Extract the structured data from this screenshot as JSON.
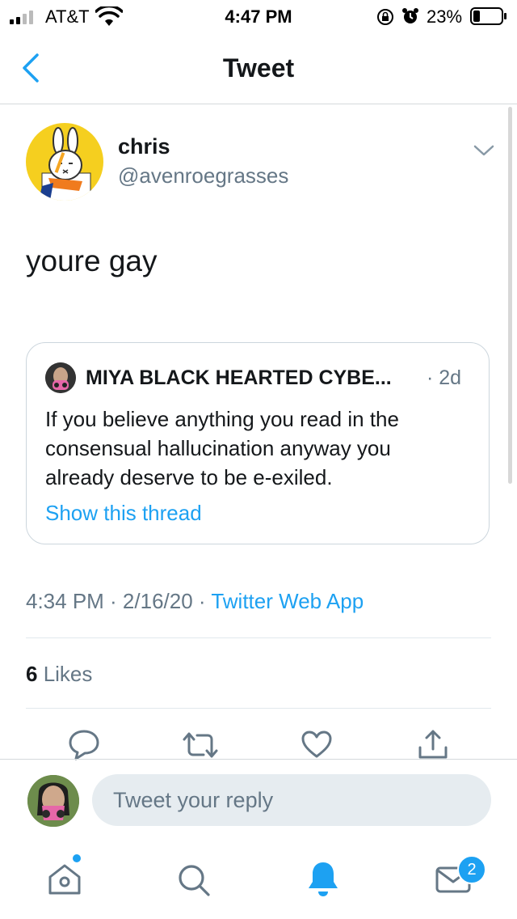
{
  "status_bar": {
    "carrier": "AT&T",
    "time": "4:47 PM",
    "battery": "23%"
  },
  "header": {
    "title": "Tweet"
  },
  "tweet": {
    "name": "chris",
    "handle": "@avenroegrasses",
    "text": "youre gay",
    "timestamp": "4:34 PM · 2/16/20 · ",
    "source": "Twitter Web App",
    "likes_count": "6",
    "likes_label": " Likes"
  },
  "quoted_tweet": {
    "name": "MIYA BLACK HEARTED CYBE...",
    "time": "· 2d",
    "text": "If you believe anything you read in the consensual hallucination anyway you already deserve to be e-exiled.",
    "link": "Show this thread"
  },
  "reply": {
    "placeholder": "Tweet your reply"
  },
  "tabbar": {
    "messages_badge": "2"
  },
  "colors": {
    "accent": "#1da1f2",
    "secondary_text": "#657786",
    "border": "#ccd6dd"
  },
  "icons": [
    "back-chevron-icon",
    "caret-down-icon",
    "reply-icon",
    "retweet-icon",
    "like-icon",
    "share-icon",
    "home-icon",
    "search-icon",
    "notifications-bell-icon",
    "messages-envelope-icon",
    "wifi-icon",
    "battery-icon",
    "alarm-icon",
    "orientation-lock-icon"
  ]
}
